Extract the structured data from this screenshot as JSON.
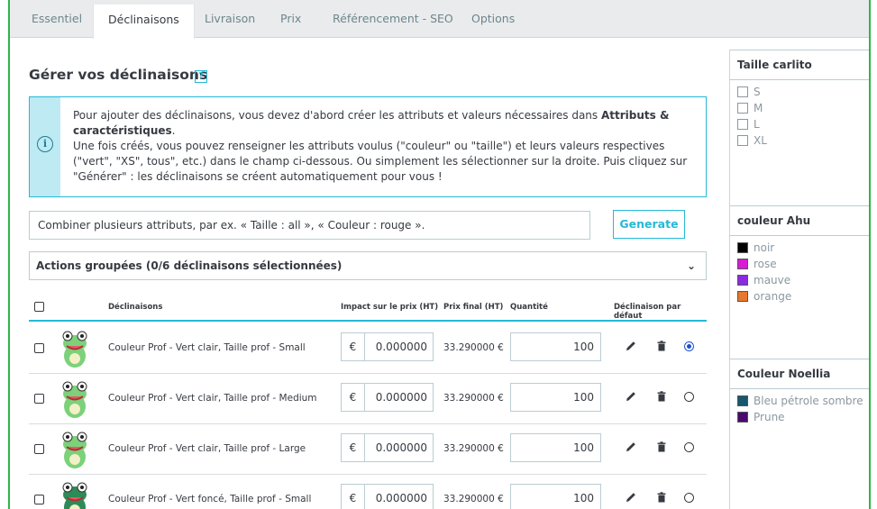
{
  "tabs": [
    "Essentiel",
    "Déclinaisons",
    "Livraison",
    "Prix",
    "Référencement - SEO",
    "Options"
  ],
  "active_tab": "Déclinaisons",
  "section": {
    "title": "Gérer vos déclinaisons",
    "help_icon": "?",
    "info_icon": "i"
  },
  "info": {
    "line1_a": "Pour ajouter des déclinaisons, vous devez d'abord créer les attributs et valeurs nécessaires dans ",
    "line1_b": "Attributs & caractéristiques",
    "line1_c": ".",
    "line2": "Une fois créés, vous pouvez renseigner les attributs voulus (\"couleur\" ou \"taille\") et leurs valeurs respectives (\"vert\", \"XS\", tous\", etc.) dans le champ ci-dessous. Ou simplement les sélectionner sur la droite. Puis cliquez sur \"Générer\" : les déclinaisons se créent automatiquement pour vous !"
  },
  "combine": {
    "placeholder": "Combiner plusieurs attributs, par ex. « Taille : all », « Couleur : rouge ».",
    "button": "Generate"
  },
  "bulk": {
    "label": "Actions groupées (0/6 déclinaisons sélectionnées)",
    "chevron": "⌄"
  },
  "table": {
    "headers": {
      "name": "Déclinaisons",
      "impact": "Impact sur le prix (HT)",
      "final": "Prix final (HT)",
      "qty": "Quantité",
      "default": "Déclinaison par défaut"
    },
    "rows": [
      {
        "name": "Couleur Prof - Vert clair, Taille prof - Small",
        "currency": "€",
        "impact": "0.000000",
        "final": "33.290000 €",
        "qty": "100",
        "default": true,
        "frog_color": "#7cd17a"
      },
      {
        "name": "Couleur Prof - Vert clair, Taille prof - Medium",
        "currency": "€",
        "impact": "0.000000",
        "final": "33.290000 €",
        "qty": "100",
        "default": false,
        "frog_color": "#7cd17a"
      },
      {
        "name": "Couleur Prof - Vert clair, Taille prof - Large",
        "currency": "€",
        "impact": "0.000000",
        "final": "33.290000 €",
        "qty": "100",
        "default": false,
        "frog_color": "#7cd17a"
      },
      {
        "name": "Couleur Prof - Vert foncé, Taille prof - Small",
        "currency": "€",
        "impact": "0.000000",
        "final": "33.290000 €",
        "qty": "100",
        "default": false,
        "frog_color": "#2e8b57"
      }
    ]
  },
  "sidebar": {
    "panels": [
      {
        "title": "Taille carlito",
        "options": [
          {
            "label": "S"
          },
          {
            "label": "M"
          },
          {
            "label": "L"
          },
          {
            "label": "XL"
          }
        ]
      },
      {
        "title": "couleur Ahu",
        "options": [
          {
            "label": "noir",
            "color": "#000000"
          },
          {
            "label": "rose",
            "color": "#d61ad6"
          },
          {
            "label": "mauve",
            "color": "#8a2be2"
          },
          {
            "label": "orange",
            "color": "#e8782b"
          }
        ]
      },
      {
        "title": "Couleur Noellia",
        "options": [
          {
            "label": "Bleu pétrole sombre",
            "color": "#16586e"
          },
          {
            "label": "Prune",
            "color": "#4b0a6e"
          }
        ]
      }
    ]
  },
  "colors": {
    "accent": "#25b9d7",
    "frame": "#2fb44b",
    "radio_selected": "#1c4fd0"
  }
}
